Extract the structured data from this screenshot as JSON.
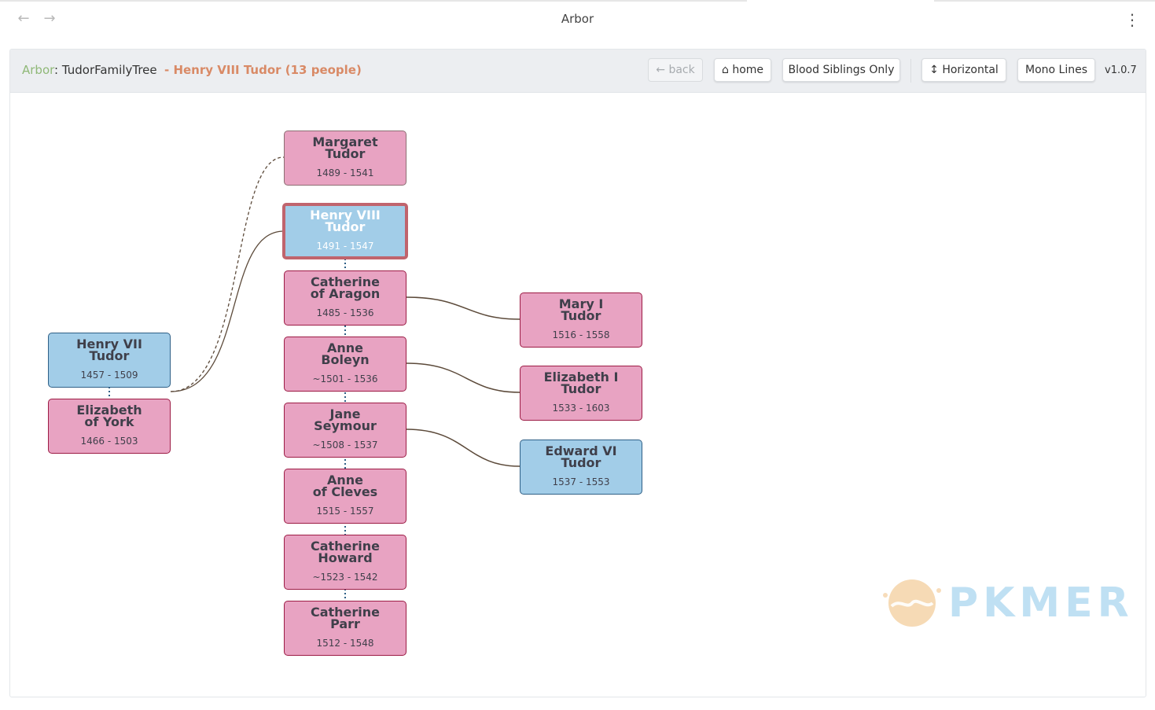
{
  "window": {
    "title": "Arbor",
    "back_glyph": "←",
    "forward_glyph": "→",
    "menu_glyph": "⋮"
  },
  "toolbar": {
    "brand": "Arbor",
    "separator": ": ",
    "file": "TudorFamilyTree",
    "focus": "- Henry VIII Tudor (13 people)",
    "buttons": {
      "back": "← back",
      "home": "⌂ home",
      "blood": "Blood Siblings Only",
      "orientation": "↕ Horizontal",
      "mono": "Mono Lines"
    },
    "version": "v1.0.7"
  },
  "people": [
    {
      "id": "henry7",
      "name_lines": [
        "Henry VII",
        "Tudor"
      ],
      "dates": "1457 - 1509",
      "sex": "male"
    },
    {
      "id": "elizabeth_york",
      "name_lines": [
        "Elizabeth",
        "of York"
      ],
      "dates": "1466 - 1503",
      "sex": "female"
    },
    {
      "id": "margaret",
      "name_lines": [
        "Margaret",
        "Tudor"
      ],
      "dates": "1489 - 1541",
      "sex": "female"
    },
    {
      "id": "henry8",
      "name_lines": [
        "Henry VIII",
        "Tudor"
      ],
      "dates": "1491 - 1547",
      "sex": "male",
      "selected": true
    },
    {
      "id": "catherine_aragon",
      "name_lines": [
        "Catherine",
        "of Aragon"
      ],
      "dates": "1485 - 1536",
      "sex": "female"
    },
    {
      "id": "anne_boleyn",
      "name_lines": [
        "Anne",
        "Boleyn"
      ],
      "dates": "~1501 - 1536",
      "sex": "female"
    },
    {
      "id": "jane_seymour",
      "name_lines": [
        "Jane",
        "Seymour"
      ],
      "dates": "~1508 - 1537",
      "sex": "female"
    },
    {
      "id": "anne_cleves",
      "name_lines": [
        "Anne",
        "of Cleves"
      ],
      "dates": "1515 - 1557",
      "sex": "female"
    },
    {
      "id": "catherine_howard",
      "name_lines": [
        "Catherine",
        "Howard"
      ],
      "dates": "~1523 - 1542",
      "sex": "female"
    },
    {
      "id": "catherine_parr",
      "name_lines": [
        "Catherine",
        "Parr"
      ],
      "dates": "1512 - 1548",
      "sex": "female"
    },
    {
      "id": "mary1",
      "name_lines": [
        "Mary I",
        "Tudor"
      ],
      "dates": "1516 - 1558",
      "sex": "female"
    },
    {
      "id": "elizabeth1",
      "name_lines": [
        "Elizabeth I",
        "Tudor"
      ],
      "dates": "1533 - 1603",
      "sex": "female"
    },
    {
      "id": "edward6",
      "name_lines": [
        "Edward VI",
        "Tudor"
      ],
      "dates": "1537 - 1553",
      "sex": "male"
    }
  ],
  "colors": {
    "female_fill": "#e8a3c2",
    "male_fill": "#a2cde8",
    "selected_border": "#c0646d",
    "link": "#5c4a3a",
    "brand": "#8fb877",
    "focus": "#d98a66"
  },
  "watermark": {
    "text": "PKMER"
  }
}
